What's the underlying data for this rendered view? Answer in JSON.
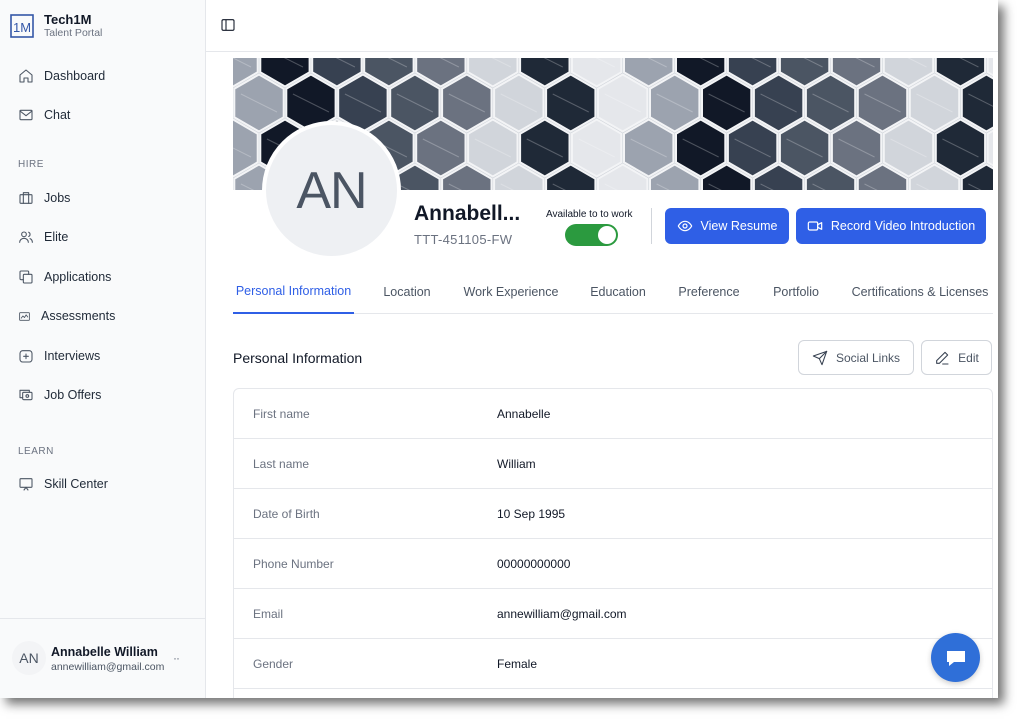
{
  "brand": {
    "title": "Tech1M",
    "subtitle": "Talent Portal",
    "logo_text": "1M"
  },
  "nav": {
    "dashboard": "Dashboard",
    "chat": "Chat",
    "hire_label": "HIRE",
    "jobs": "Jobs",
    "elite": "Elite",
    "applications": "Applications",
    "assessments": "Assessments",
    "interviews": "Interviews",
    "job_offers": "Job Offers",
    "learn_label": "LEARN",
    "skill_center": "Skill Center"
  },
  "user": {
    "initials": "AN",
    "name": "Annabelle William",
    "email": "annewilliam@gmail.com",
    "more": "··"
  },
  "profile": {
    "initials": "AN",
    "name": "Annabell...",
    "id": "TTT-451105-FW",
    "availability_label": "Available to to work",
    "available": true,
    "view_resume": "View Resume",
    "record_video": "Record Video Introduction"
  },
  "tabs": [
    {
      "label": "Personal Information",
      "active": true
    },
    {
      "label": "Location",
      "active": false
    },
    {
      "label": "Work Experience",
      "active": false
    },
    {
      "label": "Education",
      "active": false
    },
    {
      "label": "Preference",
      "active": false
    },
    {
      "label": "Portfolio",
      "active": false
    },
    {
      "label": "Certifications & Licenses",
      "active": false
    }
  ],
  "section": {
    "title": "Personal Information",
    "social_links": "Social Links",
    "edit": "Edit"
  },
  "fields": [
    {
      "label": "First name",
      "value": "Annabelle"
    },
    {
      "label": "Last name",
      "value": "William"
    },
    {
      "label": "Date of Birth",
      "value": "10 Sep 1995"
    },
    {
      "label": "Phone Number",
      "value": "00000000000"
    },
    {
      "label": "Email",
      "value": "annewilliam@gmail.com"
    },
    {
      "label": "Gender",
      "value": "Female"
    }
  ],
  "colors": {
    "accent": "#2f5fe6",
    "toggle_on": "#2b9a3f",
    "chat_fab": "#2f6fd8"
  }
}
